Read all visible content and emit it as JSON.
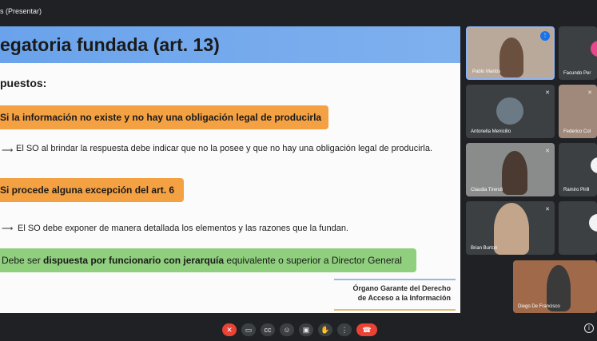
{
  "window": {
    "title": "s (Presentar)"
  },
  "slide": {
    "header": "egatoria fundada (art. 13)",
    "subtitle": "puestos:",
    "case1": "Si la información no existe y no hay una obligación legal de producirla",
    "bullet1": "El SO al brindar la respuesta debe indicar que no la posee y que no hay una obligación legal de producirla.",
    "case2": "Si procede alguna excepción del art. 6",
    "bullet2": "El SO debe exponer de manera detallada los elementos y las razones que la fundan.",
    "note_prefix": "Debe ser ",
    "note_bold": "dispuesta por funcionario con jerarquía",
    "note_suffix": " equivalente o superior a Director General",
    "logo_line1": "Órgano Garante del Derecho",
    "logo_line2": "de Acceso a la Información"
  },
  "participants": [
    {
      "name": "Pablo Martos",
      "icon": "speaking-icon"
    },
    {
      "name": "Facundo Per",
      "icon": ""
    },
    {
      "name": "Antonella Menicillo",
      "icon": "mic-off-icon"
    },
    {
      "name": "Federico Col",
      "icon": "mic-off-icon"
    },
    {
      "name": "Claudia Tirendi",
      "icon": "mic-off-icon"
    },
    {
      "name": "Ramiro Pirill",
      "icon": ""
    },
    {
      "name": "Brian Burton",
      "icon": "mic-off-icon"
    },
    {
      "name": "",
      "icon": ""
    },
    {
      "name": "Diego De Francisco",
      "icon": ""
    }
  ],
  "controls": {
    "mic": "mic-off-icon",
    "camera": "camera-icon",
    "captions": "captions-icon",
    "emoji": "emoji-icon",
    "present": "present-icon",
    "hand": "raise-hand-icon",
    "more": "more-icon",
    "hangup": "hangup-icon",
    "info": "info-icon"
  },
  "colors": {
    "header": "#6aa3ec",
    "orange": "#f4a143",
    "green": "#8fcf7d",
    "hangup": "#ea4335"
  }
}
